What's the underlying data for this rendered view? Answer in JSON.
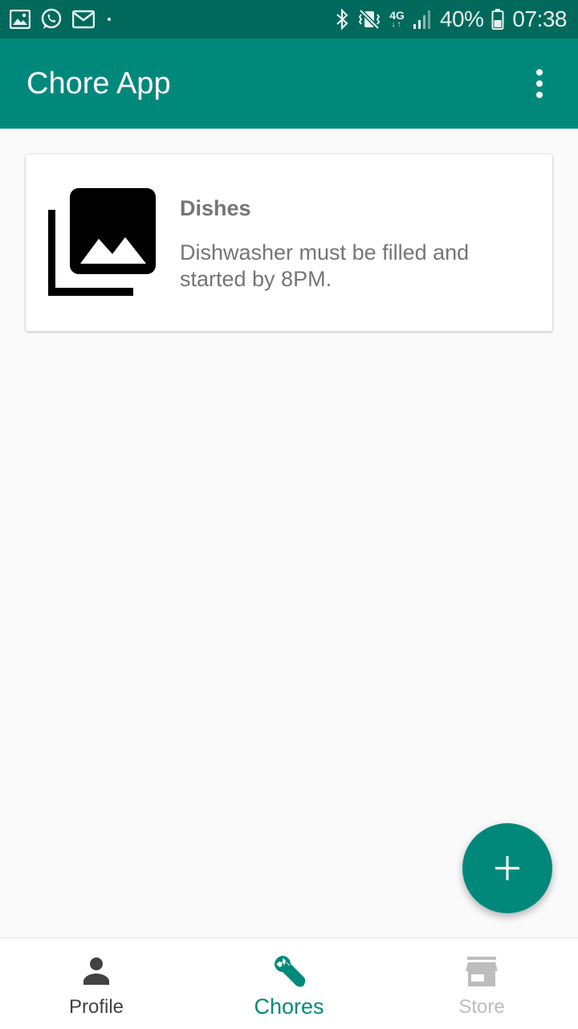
{
  "status_bar": {
    "battery": "40%",
    "time": "07:38",
    "network": "4G",
    "left_icons": [
      "gallery-icon",
      "whatsapp-icon",
      "mail-icon"
    ],
    "right_icons": [
      "bluetooth-icon",
      "vibrate-icon",
      "signal-icon",
      "battery-icon"
    ]
  },
  "app_bar": {
    "title": "Chore App",
    "overflow_icon": "more-vert-icon"
  },
  "chores": [
    {
      "title": "Dishes",
      "description": "Dishwasher must be filled and started by 8PM.",
      "thumbnail_icon": "photo-library-icon"
    }
  ],
  "fab": {
    "icon": "add-icon"
  },
  "bottom_nav": {
    "items": [
      {
        "label": "Profile",
        "icon": "person-icon",
        "state": "enabled"
      },
      {
        "label": "Chores",
        "icon": "wrench-icon",
        "state": "selected"
      },
      {
        "label": "Store",
        "icon": "store-icon",
        "state": "disabled"
      }
    ]
  },
  "colors": {
    "status_bar": "#00695c",
    "primary": "#00897b",
    "background": "#fafafa",
    "card_text": "#757575",
    "nav_inactive": "#757575",
    "nav_disabled": "#bdbdbd"
  }
}
